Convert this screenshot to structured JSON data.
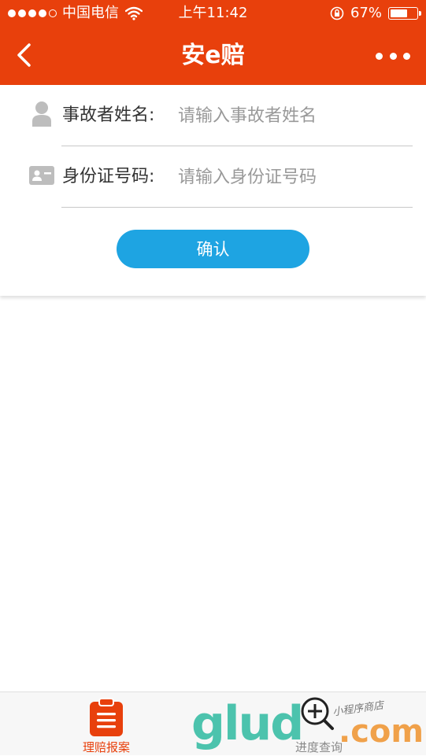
{
  "status_bar": {
    "carrier": "中国电信",
    "time": "上午11:42",
    "battery": "67%",
    "battery_level": 0.67,
    "signal_strength": 4,
    "signal_max": 5
  },
  "nav": {
    "title": "安e赔",
    "back_icon": "chevron-left-icon",
    "more_icon": "more-dots-icon"
  },
  "form": {
    "name_label": "事故者姓名:",
    "name_placeholder": "请输入事故者姓名",
    "name_value": "",
    "name_icon": "person-icon",
    "id_label": "身份证号码:",
    "id_placeholder": "请输入身份证号码",
    "id_value": "",
    "id_icon": "id-card-icon",
    "confirm_label": "确认"
  },
  "tabs": [
    {
      "label": "理赔报案",
      "icon": "clipboard-icon",
      "active": true
    },
    {
      "label": "进度查询",
      "icon": "progress-icon",
      "active": false
    }
  ],
  "watermark": {
    "main": "glud",
    "suffix": ".com",
    "tagline": "小程序商店"
  },
  "colors": {
    "brand": "#e8400c",
    "button": "#1ea4e2",
    "watermark_green": "#4cc3ad",
    "watermark_orange": "#f0a14a"
  }
}
